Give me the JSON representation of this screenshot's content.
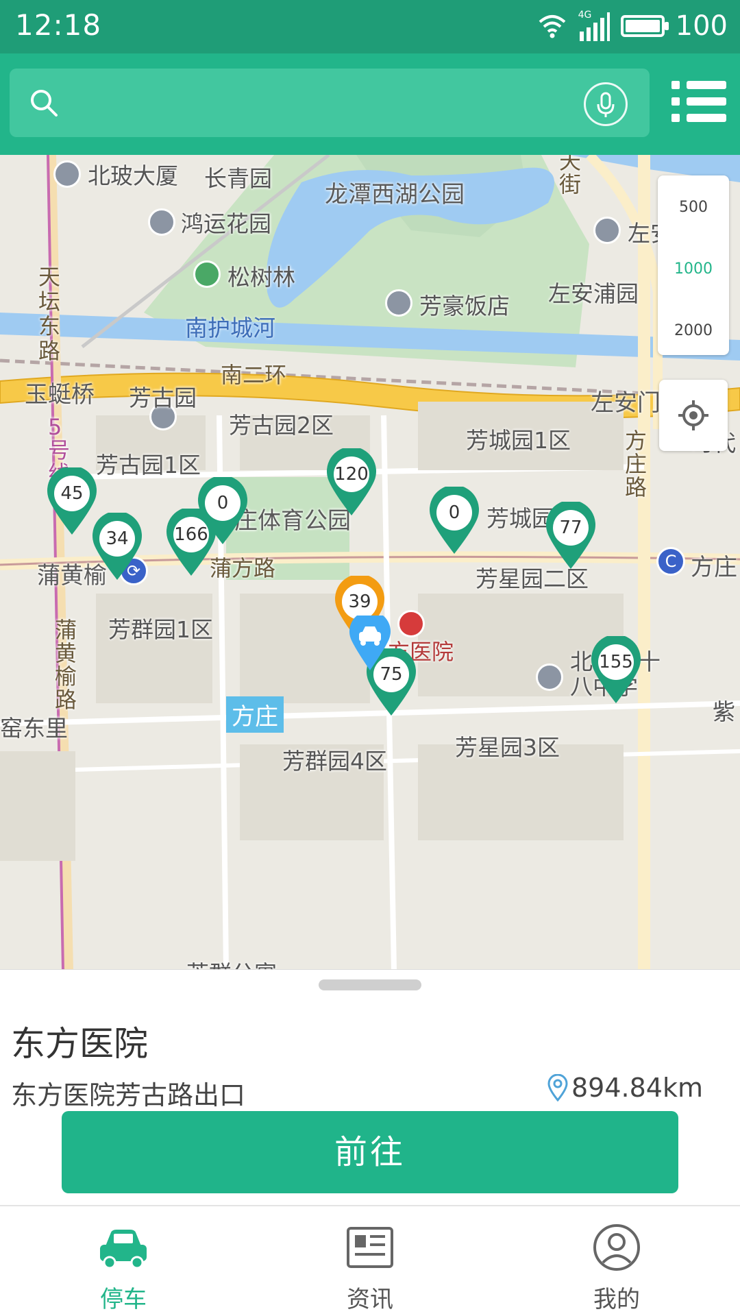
{
  "status_bar": {
    "time": "12:18",
    "network": "4G",
    "battery": "100"
  },
  "header": {
    "search_placeholder": "",
    "search_icon": "search-icon",
    "mic_icon": "microphone-icon",
    "menu_icon": "menu-list-icon"
  },
  "map": {
    "labels": {
      "beipo": "北玻大厦",
      "changqing": "长青园",
      "longtan": "龙潭西湖公园",
      "hongyun": "鸿运花园",
      "songshulin": "松树林",
      "zuoan_top": "左安",
      "fanghao": "芳豪饭店",
      "zuoanpu": "左安浦园",
      "nanhuchenghe": "南护城河",
      "nanerhuan": "南二环",
      "yutingqiao": "玉蜓桥",
      "zuoanmenqiao": "左安门桥",
      "tiantandonglu": "天坛东路",
      "line5": "5号线",
      "fanggu": "芳古园",
      "fanggu2": "芳古园2区",
      "fangcheng1": "芳城园1区",
      "fangzhuanglu": "方庄路",
      "shidai": "时代",
      "fanggu1": "芳古园1区",
      "tiyu": "庄体育公园",
      "fangcheng_qu": "芳城园区",
      "puhuangyu": "蒲黄榆",
      "pufanglu": "蒲方路",
      "fangxing2": "芳星园二区",
      "fangzhuang_right": "方庄",
      "fangqun1": "芳群园1区",
      "dongfang": "东方医院",
      "beijing18": "北京第十八中学",
      "puhuangyulu": "蒲黄榆路",
      "yaodongli": "窑东里",
      "fangzhuang_station": "方庄",
      "zi": "紫",
      "fangqun4": "芳群园4区",
      "fangxing3": "芳星园3区",
      "fangqun_gongyu": "芳群公寓",
      "tiangai": "天街"
    },
    "pins": [
      {
        "count": "45",
        "color": "#1fa07a"
      },
      {
        "count": "34",
        "color": "#1fa07a"
      },
      {
        "count": "166",
        "color": "#1fa07a"
      },
      {
        "count": "0",
        "color": "#1fa07a"
      },
      {
        "count": "120",
        "color": "#1fa07a"
      },
      {
        "count": "0",
        "color": "#1fa07a"
      },
      {
        "count": "77",
        "color": "#1fa07a"
      },
      {
        "count": "39",
        "color": "#f39c12"
      },
      {
        "count": "75",
        "color": "#1fa07a"
      },
      {
        "count": "155",
        "color": "#1fa07a"
      }
    ],
    "scale": [
      "500",
      "1000",
      "2000"
    ],
    "scale_selected": "1000",
    "colors": {
      "accent": "#22b58a",
      "selected_pin": "#f39c12",
      "car_pin": "#3fa9f5"
    }
  },
  "sheet": {
    "title": "东方医院",
    "subtitle": "东方医院芳古路出口",
    "distance": "894.84km",
    "go_label": "前往"
  },
  "tabs": [
    {
      "label": "停车",
      "icon": "car-icon",
      "active": true
    },
    {
      "label": "资讯",
      "icon": "news-icon",
      "active": false
    },
    {
      "label": "我的",
      "icon": "profile-icon",
      "active": false
    }
  ]
}
